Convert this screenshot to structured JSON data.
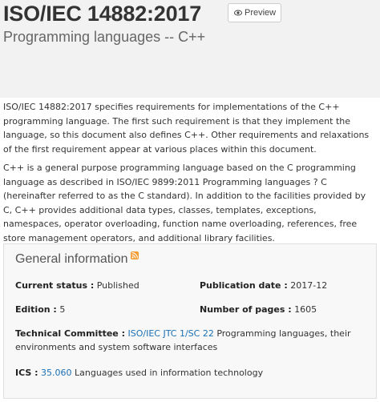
{
  "header": {
    "title": "ISO/IEC 14882:2017",
    "preview_label": "Preview",
    "subtitle": "Programming languages -- C++"
  },
  "abstract": {
    "p1": "ISO/IEC 14882:2017 specifies requirements for implementations of the C++ programming language. The first such requirement is that they implement the language, so this document also defines C++. Other requirements and relaxations of the first requirement appear at various places within this document.",
    "p2": "C++ is a general purpose programming language based on the C programming language as described in ISO/IEC 9899:2011 Programming languages ? C (hereinafter referred to as the C standard). In addition to the facilities provided by C, C++ provides additional data types, classes, templates, exceptions, namespaces, operator overloading, function name overloading, references, free store management operators, and additional library facilities."
  },
  "general_info": {
    "title": "General information",
    "current_status_label": "Current status :",
    "current_status_value": "Published",
    "publication_date_label": "Publication date :",
    "publication_date_value": "2017-12",
    "edition_label": "Edition :",
    "edition_value": "5",
    "pages_label": "Number of pages :",
    "pages_value": "1605",
    "tc_label": "Technical Committee :",
    "tc_link": "ISO/IEC JTC 1/SC 22",
    "tc_text": "Programming languages, their environments and system software interfaces",
    "ics_label": "ICS :",
    "ics_link": "35.060",
    "ics_text": "Languages used in information technology"
  },
  "colors": {
    "link": "#1a6fb3",
    "rss": "#f39c34",
    "header_bg": "#f2f2f2"
  },
  "icons": {
    "preview": "eye-icon",
    "feed": "rss-icon"
  }
}
